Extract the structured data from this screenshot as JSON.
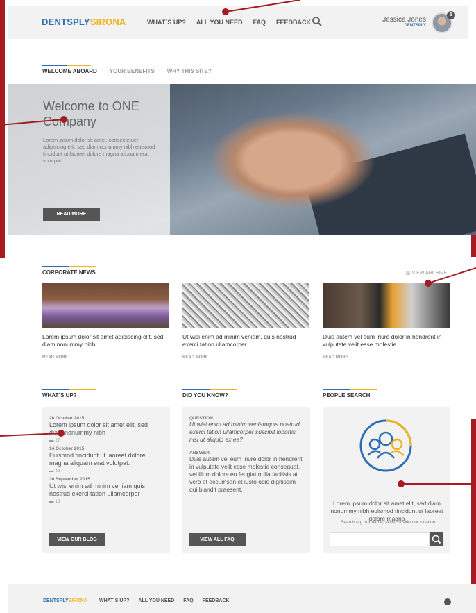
{
  "header": {
    "logo_part1": "DENTSPLY",
    "logo_part2": "SIRONA",
    "nav": [
      "WHAT´S UP?",
      "ALL YOU NEED",
      "FAQ",
      "FEEDBACK"
    ],
    "user_name": "Jessica Jones",
    "user_company": "DENTSPLY",
    "badge": "5"
  },
  "tabs": [
    "WELCOME ABOARD",
    "YOUR BENEFITS",
    "WHY THIS SITE?"
  ],
  "hero": {
    "title": "Welcome to ONE Company",
    "text": "Lorem ipsum dolor sit amet, consectetuer adipiscing elit, sed diam nonummy nibh euismod tincidunt ut laoreet dolore magna aliquam erat volutpat.",
    "button": "READ MORE"
  },
  "news": {
    "title": "CORPORATE NEWS",
    "archive": "VIEW ARCHIVE",
    "items": [
      {
        "text": "Lorem ipsum dolor sit amet  adipiscing elit, sed diam nonummy nibh",
        "more": "READ MORE"
      },
      {
        "text": "Ut wisi enim ad minim veniam, quis nostrud exerci tation ullamcorper",
        "more": "READ MORE"
      },
      {
        "text": "Duis autem vel eum iriure dolor in hendrerit in vulputate velit esse molestie",
        "more": "READ MORE"
      }
    ]
  },
  "whats_up": {
    "title": "WHAT´S UP?",
    "items": [
      {
        "date": "26 October 2015",
        "text": "Lorem ipsum dolor sit amet  elit, sed diam nonummy nibh",
        "count": "27"
      },
      {
        "date": "14 October 2015",
        "text": "Euismod tincidunt ut laoreet dolore magna aliquam erat volutpat.",
        "count": "42"
      },
      {
        "date": "30 September 2015",
        "text": "Ut wisi enim ad minim veniam quis nostrud exerci tation ullamcorper",
        "count": "13"
      }
    ],
    "button": "VIEW OUR BLOG"
  },
  "did_you_know": {
    "title": "DID YOU KNOW?",
    "question_label": "QUESTION",
    "question": "Ut wisi enim ad minim veniamquis nostrud exerci tation ullamcorper suscipit lobortis nisl ut aliquip ex ea?",
    "answer_label": "ANSWER",
    "answer": "Duis autem vel eum iriure dolor in hendrerit in vulputate velit esse molestie consequat, vel illum dolore eu feugiat nulla facilisis at vero et accumsan et iusto odio dignissim qui blandit praesent.",
    "button": "VIEW ALL FAQ"
  },
  "people_search": {
    "title": "PEOPLE SEARCH",
    "text": "Lorem ipsum dolor sit amet  elit, sed diam nonummy nibh euismod tincidunt ut laoreet dolore magna",
    "hint": "Search e.g. for name, skills, position or location.",
    "input_value": ""
  },
  "footer": {
    "logo_part1": "DENTSPLY",
    "logo_part2": "SIRONA",
    "nav": [
      "WHAT´S UP?",
      "ALL YOU NEED",
      "FAQ",
      "FEEDBACK"
    ]
  },
  "colors": {
    "brand_blue": "#2d6db5",
    "brand_yellow": "#f0b323",
    "annotation_red": "#a61c24",
    "button_dark": "#555555"
  }
}
